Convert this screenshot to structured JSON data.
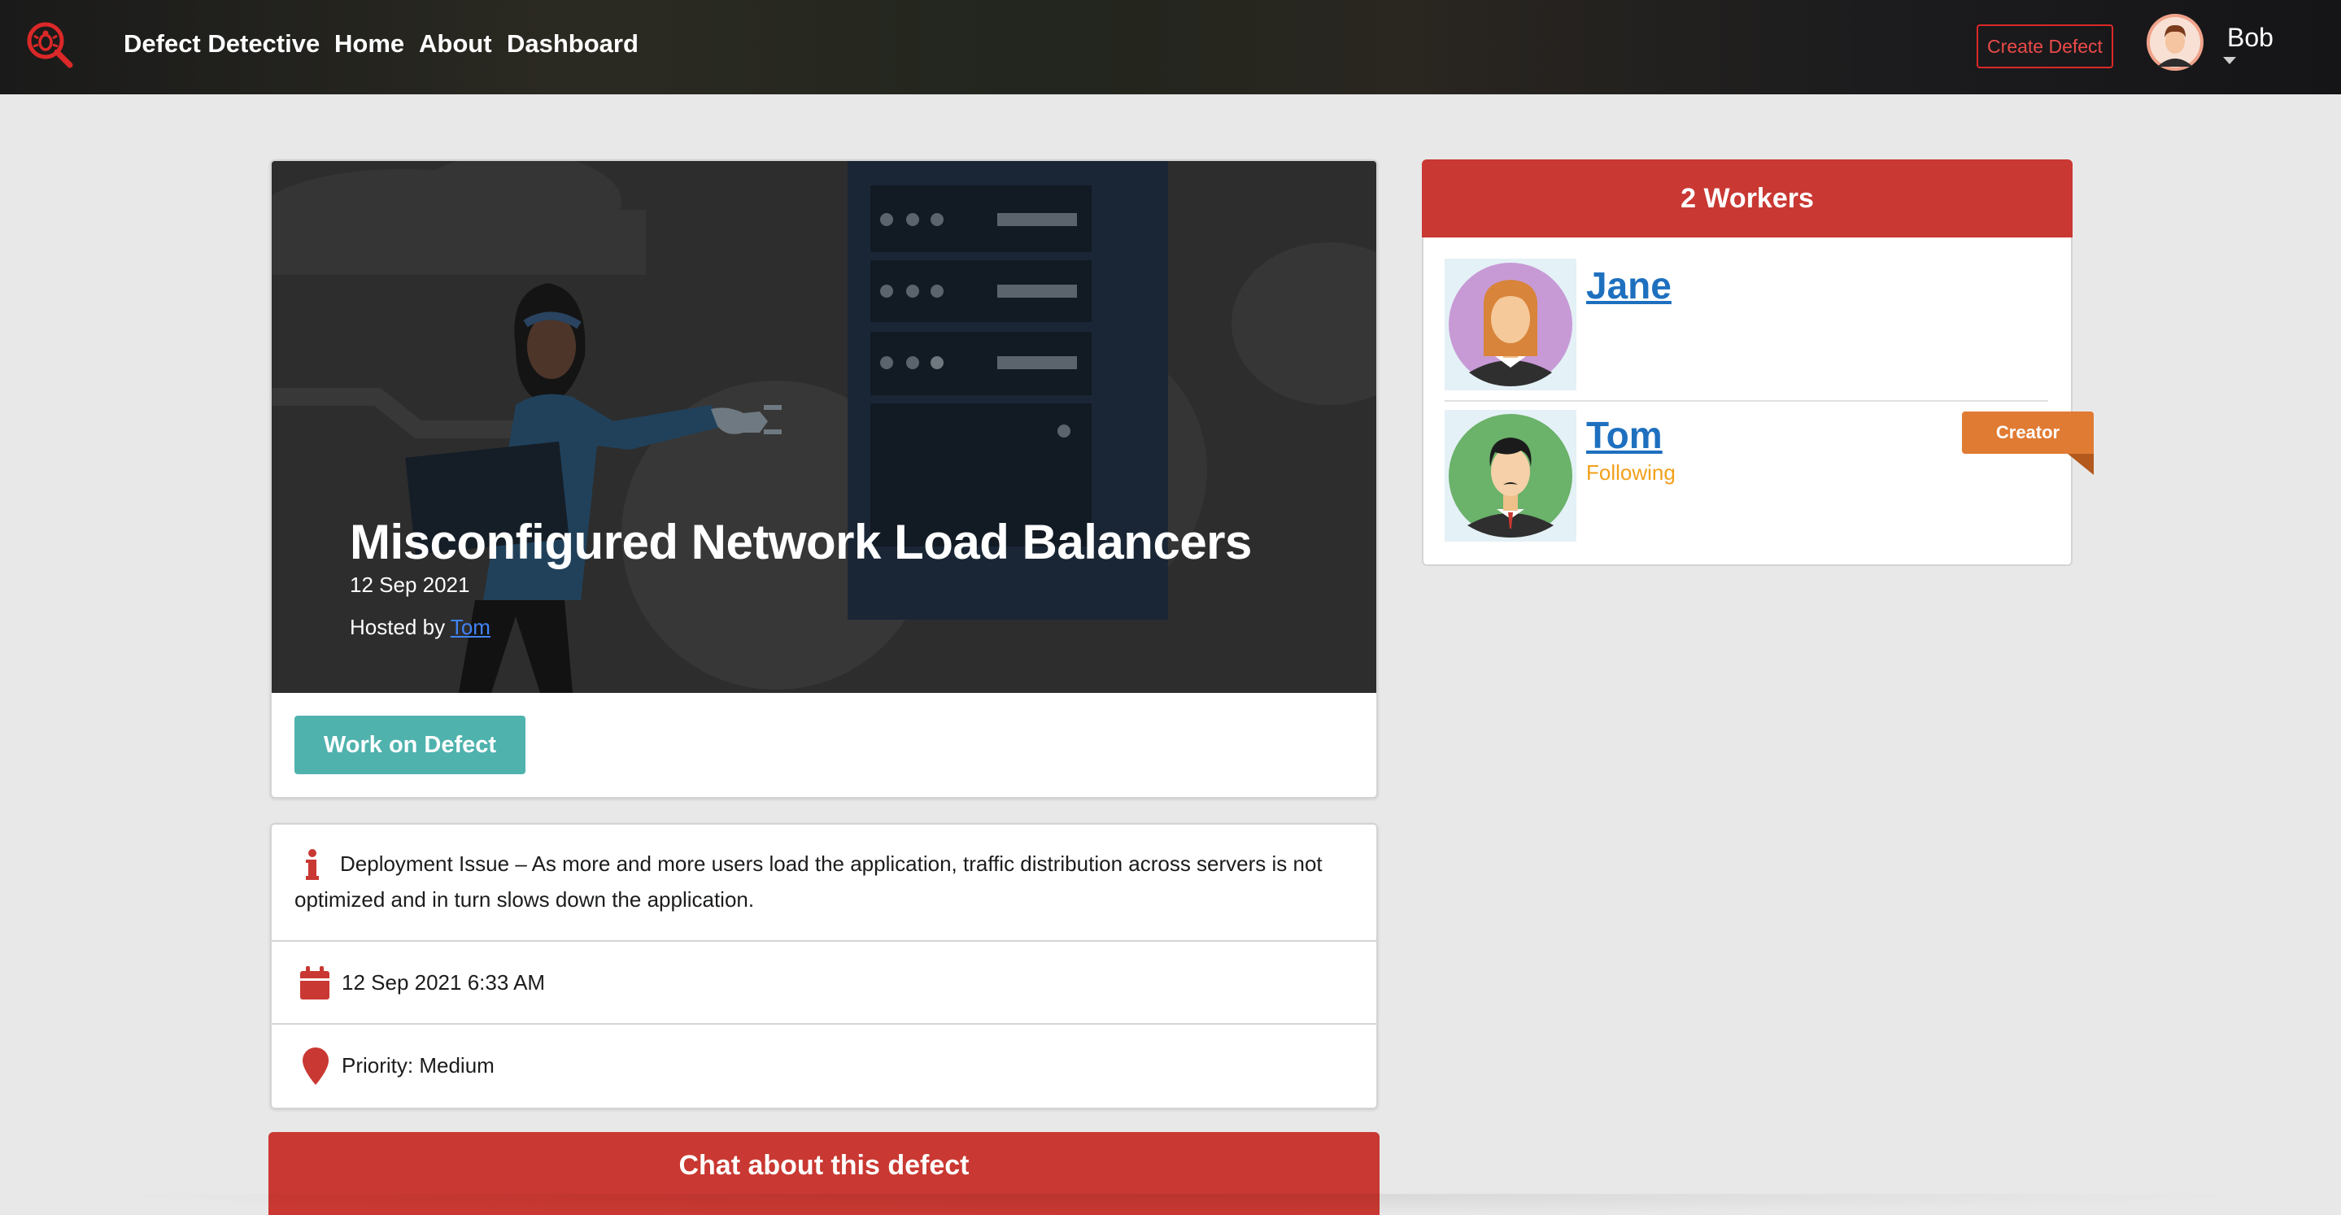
{
  "navbar": {
    "brand": "Defect Detective",
    "links": [
      "Home",
      "About",
      "Dashboard"
    ],
    "create_button": "Create Defect",
    "user_name": "Bob",
    "logo_icon": "bug-magnifier-icon",
    "accent_color": "#db2828"
  },
  "defect": {
    "title": "Misconfigured Network Load Balancers",
    "date": "12 Sep 2021",
    "hosted_by_prefix": "Hosted by",
    "host_name": "Tom",
    "work_button": "Work on Defect",
    "description": "Deployment Issue – As more and more users load the application, traffic distribution across servers is not optimized and in turn slows down the application.",
    "datetime": "12 Sep 2021 6:33 AM",
    "priority": "Priority: Medium",
    "chat_button": "Chat about this defect",
    "icons": {
      "description": "info-icon",
      "datetime": "calendar-icon",
      "priority": "map-marker-icon"
    }
  },
  "workers": {
    "header": "2 Workers",
    "list": [
      {
        "name": "Jane",
        "status": "",
        "tag": ""
      },
      {
        "name": "Tom",
        "status": "Following",
        "tag": "Creator"
      }
    ]
  },
  "colors": {
    "primary_red": "#c93832",
    "teal": "#4fb2ad",
    "creator_orange": "#e07b33",
    "following_yellow": "#f2a01b",
    "link_blue": "#1e70bf"
  }
}
